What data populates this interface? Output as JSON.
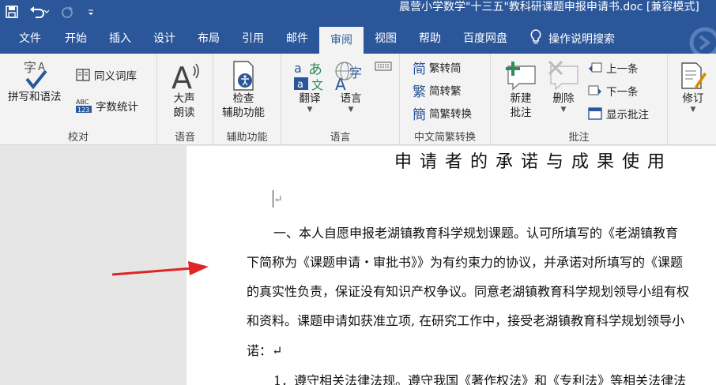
{
  "window": {
    "title": "晨营小学数学\"十三五\"教科研课题申报申请书.doc [兼容模式]"
  },
  "tabs": [
    {
      "label": "文件",
      "active": false
    },
    {
      "label": "开始",
      "active": false
    },
    {
      "label": "插入",
      "active": false
    },
    {
      "label": "设计",
      "active": false
    },
    {
      "label": "布局",
      "active": false
    },
    {
      "label": "引用",
      "active": false
    },
    {
      "label": "邮件",
      "active": false
    },
    {
      "label": "审阅",
      "active": true
    },
    {
      "label": "视图",
      "active": false
    },
    {
      "label": "帮助",
      "active": false
    },
    {
      "label": "百度网盘",
      "active": false
    }
  ],
  "tellme": {
    "label": "操作说明搜索",
    "icon": "lightbulb-icon"
  },
  "ribbon": {
    "proofing": {
      "group_label": "校对",
      "spelling": "拼写和语法",
      "thesaurus": "同义词库",
      "word_count": "字数统计"
    },
    "speech": {
      "group_label": "语音",
      "read_aloud_1": "大声",
      "read_aloud_2": "朗读"
    },
    "accessibility": {
      "group_label": "辅助功能",
      "check_1": "检查",
      "check_2": "辅助功能"
    },
    "language": {
      "group_label": "语言",
      "translate": "翻译",
      "language": "语言"
    },
    "chinese_conversion": {
      "group_label": "中文简繁转换",
      "to_simplified": "繁转简",
      "to_traditional": "简转繁",
      "conversion": "简繁转换"
    },
    "comments": {
      "group_label": "批注",
      "new_1": "新建",
      "new_2": "批注",
      "delete": "删除",
      "previous": "上一条",
      "next": "下一条",
      "show": "显示批注"
    },
    "tracking": {
      "revise": "修订"
    }
  },
  "document": {
    "heading": "申请者的承诺与成果使用",
    "lines": [
      "一、本人自愿申报老湖镇教育科学规划课题。认可所填写的《老湖镇教育",
      "下简称为《课题申请・审批书》》为有约束力的协议，并承诺对所填写的《课题",
      "的真实性负责，保证没有知识产权争议。同意老湖镇教育科学规划领导小组有权",
      "和资料。课题申请如获准立项, 在研究工作中，接受老湖镇教育科学规划领导小",
      "诺：↵",
      "1．遵守相关法律法规。遵守我国《著作权法》和《专利法》等相关法律法"
    ],
    "paragraph_mark": "↵"
  },
  "colors": {
    "brand": "#2b579a",
    "ribbon_bg": "#f3f3f3",
    "arrow": "#e02424"
  }
}
